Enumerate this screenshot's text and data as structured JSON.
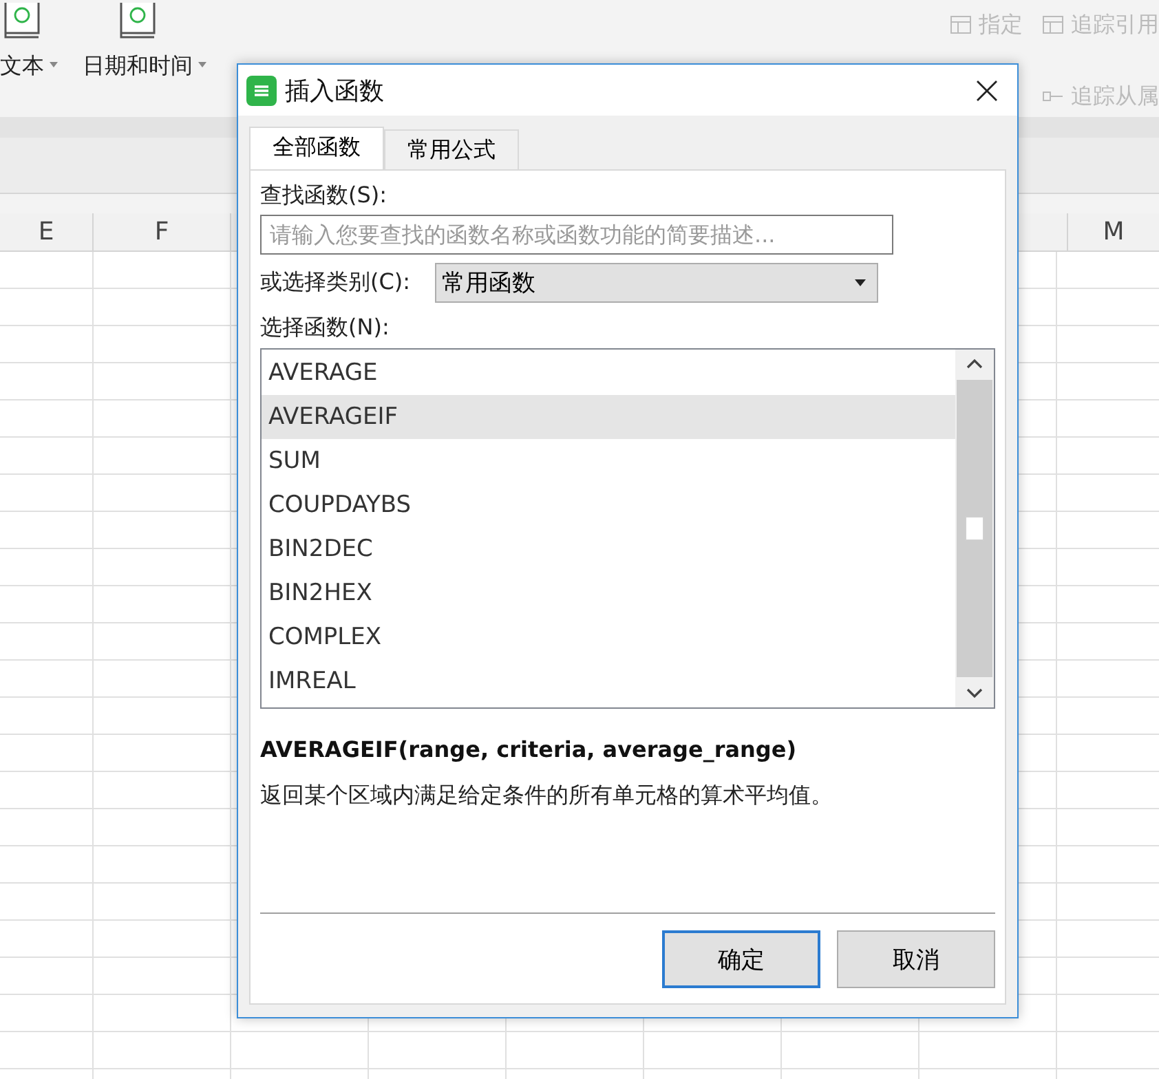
{
  "ribbon": {
    "items": [
      {
        "label": "文本",
        "kind": "category",
        "disabled": false
      },
      {
        "label": "日期和时间",
        "kind": "category",
        "disabled": false
      },
      {
        "label": "指定",
        "kind": "tool",
        "disabled": true
      },
      {
        "label": "追踪引用",
        "kind": "tool",
        "disabled": true
      }
    ],
    "extra": [
      {
        "label": "追踪从属",
        "disabled": true
      }
    ]
  },
  "sheet": {
    "columns": [
      "E",
      "F",
      "M"
    ]
  },
  "dialog": {
    "title": "插入函数",
    "tabs": [
      {
        "label": "全部函数",
        "selected": true
      },
      {
        "label": "常用公式",
        "selected": false
      }
    ],
    "search": {
      "label": "查找函数(S):",
      "placeholder": "请输入您要查找的函数名称或函数功能的简要描述..."
    },
    "category": {
      "label": "或选择类别(C):",
      "value": "常用函数"
    },
    "functions": {
      "label": "选择函数(N):",
      "items": [
        {
          "name": "AVERAGE",
          "selected": false
        },
        {
          "name": "AVERAGEIF",
          "selected": true
        },
        {
          "name": "SUM",
          "selected": false
        },
        {
          "name": "COUPDAYBS",
          "selected": false
        },
        {
          "name": "BIN2DEC",
          "selected": false
        },
        {
          "name": "BIN2HEX",
          "selected": false
        },
        {
          "name": "COMPLEX",
          "selected": false
        },
        {
          "name": "IMREAL",
          "selected": false
        }
      ]
    },
    "signature": "AVERAGEIF(range, criteria, average_range)",
    "description": "返回某个区域内满足给定条件的所有单元格的算术平均值。",
    "buttons": [
      {
        "label": "确定",
        "kind": "primary"
      },
      {
        "label": "取消",
        "kind": "secondary"
      }
    ]
  }
}
